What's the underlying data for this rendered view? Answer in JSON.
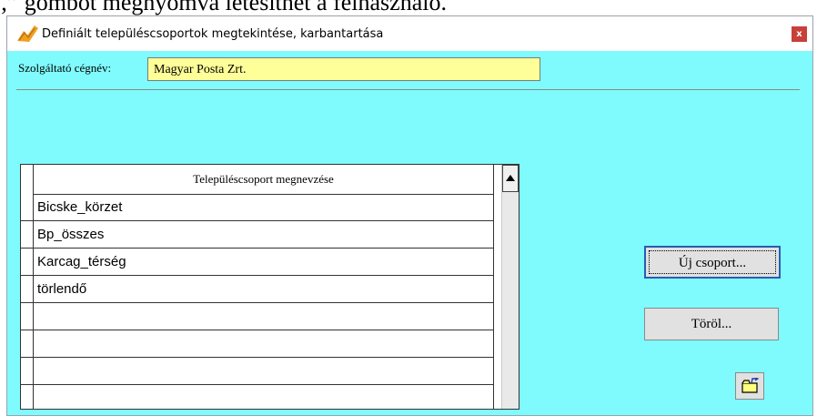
{
  "document": {
    "caption": "‚” gombot megnyomva létesíthet a felhasználó."
  },
  "window": {
    "title": "Definiált településcsoportok megtekintése, karbantartása",
    "close_label": "x"
  },
  "provider": {
    "label": "Szolgáltató cégnév:",
    "value": "Magyar Posta Zrt."
  },
  "grid": {
    "column_header": "Településcsoport megnevzése",
    "rows": [
      "Bicske_körzet",
      "Bp_összes",
      "Karcag_térség",
      "törlendő",
      "",
      "",
      "",
      ""
    ]
  },
  "buttons": {
    "new_group": "Új csoport...",
    "delete": "Töröl..."
  },
  "colors": {
    "form_background": "#7ffbfd",
    "input_background": "#ffff99",
    "close_button": "#c8403a"
  }
}
